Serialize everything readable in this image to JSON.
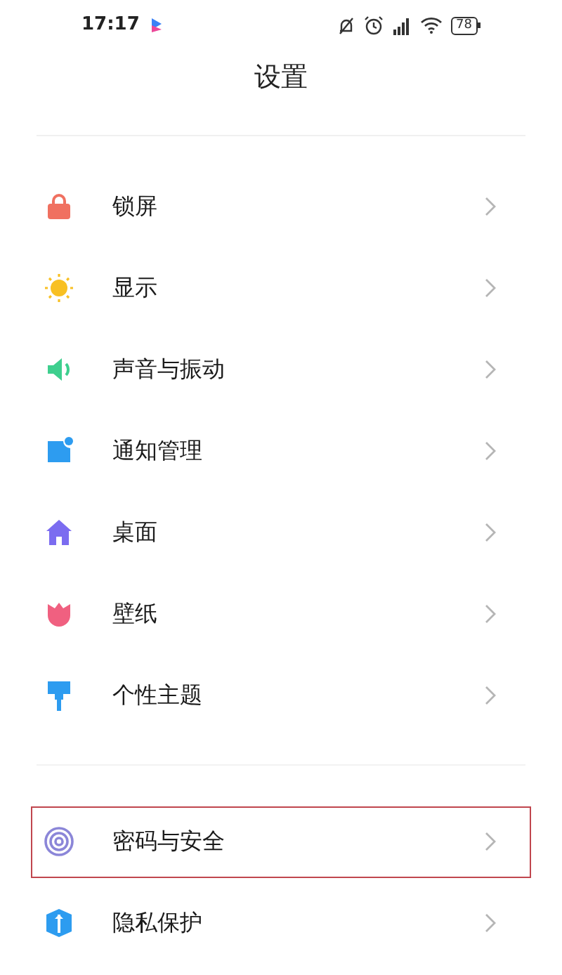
{
  "status_bar": {
    "time": "17:17",
    "battery": "78"
  },
  "title": "设置",
  "groups": [
    {
      "items": [
        {
          "label": "锁屏",
          "kind": "lock",
          "highlighted": false
        },
        {
          "label": "显示",
          "kind": "sun",
          "highlighted": false
        },
        {
          "label": "声音与振动",
          "kind": "speaker",
          "highlighted": false
        },
        {
          "label": "通知管理",
          "kind": "notification",
          "highlighted": false
        },
        {
          "label": "桌面",
          "kind": "home",
          "highlighted": false
        },
        {
          "label": "壁纸",
          "kind": "flower",
          "highlighted": false
        },
        {
          "label": "个性主题",
          "kind": "brush",
          "highlighted": false
        }
      ]
    },
    {
      "items": [
        {
          "label": "密码与安全",
          "kind": "fingerprint",
          "highlighted": true
        },
        {
          "label": "隐私保护",
          "kind": "shield",
          "highlighted": false
        }
      ]
    }
  ]
}
